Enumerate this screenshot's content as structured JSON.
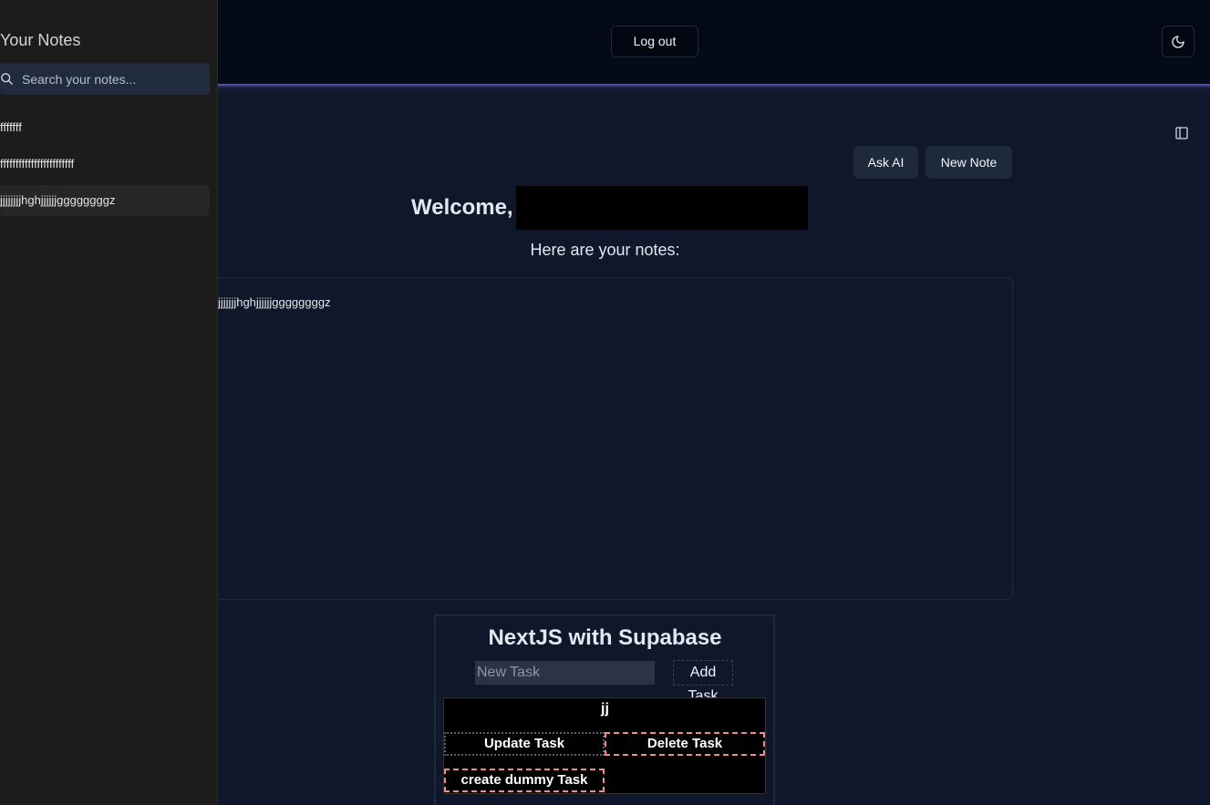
{
  "sidebar": {
    "title": "Your Notes",
    "search_placeholder": "Search your notes...",
    "notes": [
      {
        "label": "fffffff"
      },
      {
        "label": "ffffffffffffffffffffffff"
      },
      {
        "label": "jjjjjjjjhghjjjjjjggggggggz"
      }
    ],
    "active_index": 2
  },
  "header": {
    "logout_label": "Log out",
    "theme_icon": "moon-icon"
  },
  "main": {
    "ask_ai_label": "Ask AI",
    "new_note_label": "New Note",
    "welcome_label": "Welcome,",
    "subtitle": "Here are your notes:",
    "note_content": "jjjjjjjhghjjjjjjggggggggz"
  },
  "tasks": {
    "title": "NextJS with Supabase",
    "input_placeholder": "New Task",
    "add_label": "Add Task",
    "items": [
      {
        "name": "jj"
      }
    ],
    "update_label": "Update Task",
    "delete_label": "Delete Task",
    "dummy_label": "create dummy Task"
  },
  "colors": {
    "background": "#0f172a",
    "header": "#040a17",
    "sidebar": "#1c1c1c",
    "accent_glow": "#6d5fb3",
    "danger_dash": "#f28c8c"
  }
}
